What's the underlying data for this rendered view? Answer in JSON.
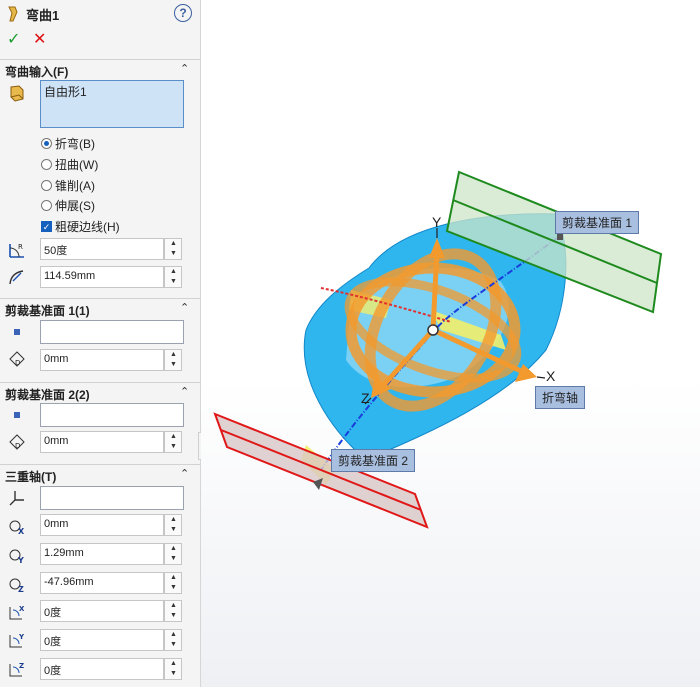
{
  "header": {
    "title": "弯曲1",
    "help_icon": "question-icon",
    "ok_icon": "checkmark-icon",
    "cancel_icon": "close-icon"
  },
  "sections": {
    "bend_input": {
      "label": "弯曲输入(F)",
      "selection": "自由形1",
      "options": [
        {
          "label": "折弯(B)",
          "selected": true
        },
        {
          "label": "扭曲(W)",
          "selected": false
        },
        {
          "label": "锥削(A)",
          "selected": false
        },
        {
          "label": "伸展(S)",
          "selected": false
        }
      ],
      "hard_edges": {
        "label": "粗硬边线(H)",
        "checked": true
      },
      "angle": "50度",
      "radius": "114.59mm"
    },
    "trim1": {
      "label": "剪裁基准面 1(1)",
      "selection": "",
      "distance": "0mm"
    },
    "trim2": {
      "label": "剪裁基准面 2(2)",
      "selection": "",
      "distance": "0mm"
    },
    "triad": {
      "label": "三重轴(T)",
      "selection": "",
      "x": "0mm",
      "y": "1.29mm",
      "z": "-47.96mm",
      "rot_x": "0度",
      "rot_y": "0度",
      "rot_z": "0度"
    }
  },
  "viewport": {
    "callouts": {
      "trim_plane_1": "剪裁基准面 1",
      "trim_plane_2": "剪裁基准面 2",
      "bend_axis": "折弯轴"
    },
    "axes": {
      "x": "X",
      "y": "Y",
      "z": "Z"
    },
    "colors": {
      "body": "#2fb6ee",
      "trim1": "#1e8a1e",
      "trim2": "#e01818",
      "triad": "#f29a2e",
      "axis": "#1a3cdc",
      "highlight": "#f1ee6a"
    }
  }
}
